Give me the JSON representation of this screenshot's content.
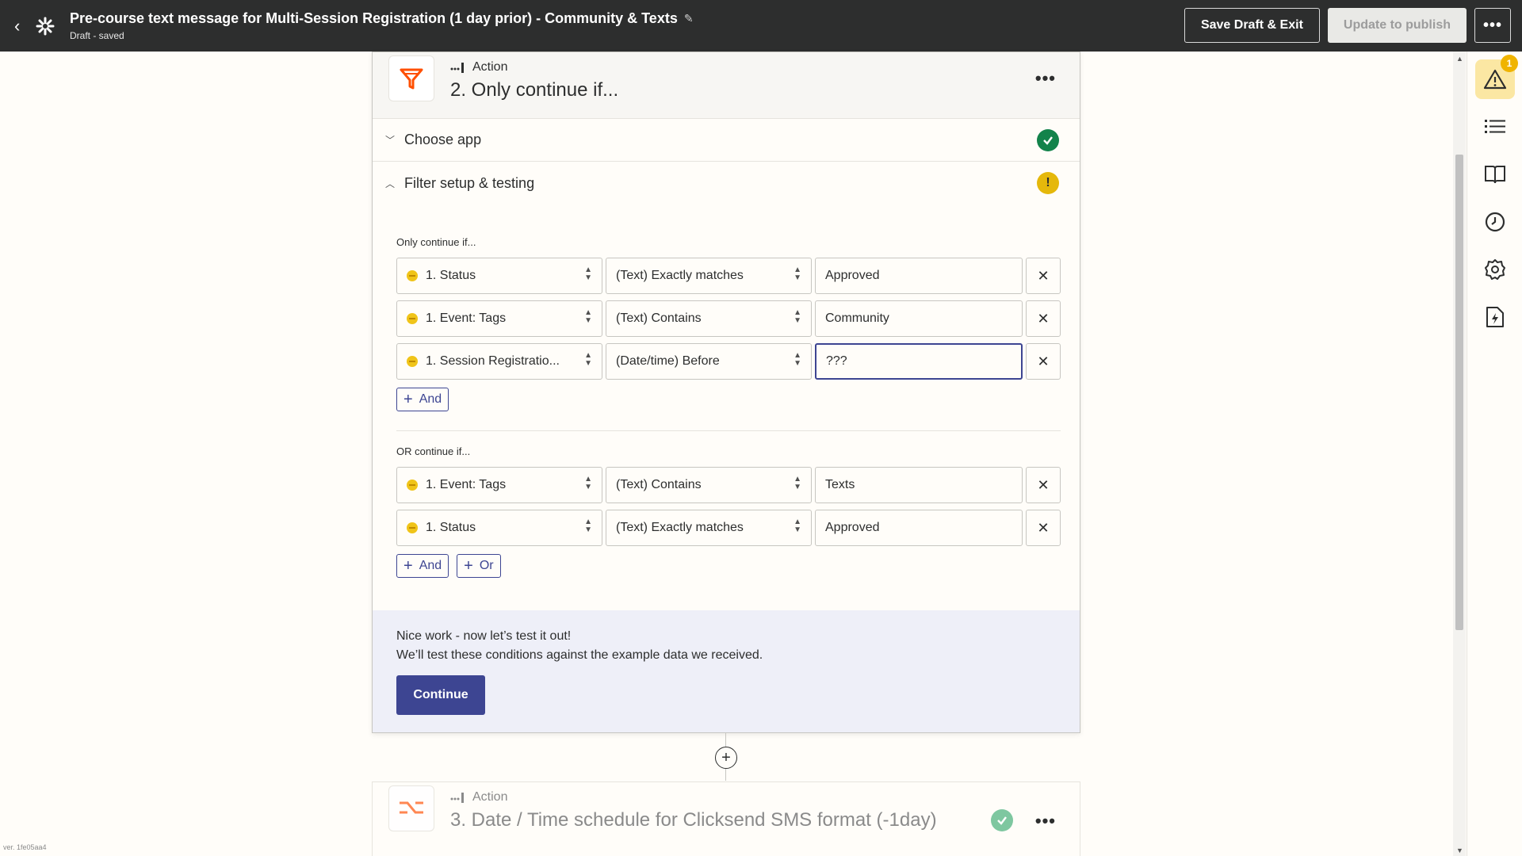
{
  "topbar": {
    "title": "Pre-course text message for Multi-Session Registration (1 day prior) - Community & Texts",
    "status": "Draft - saved",
    "save_draft_label": "Save Draft & Exit",
    "publish_label": "Update to publish",
    "more_label": "•••"
  },
  "step2": {
    "kind": "Action",
    "title": "2. Only continue if...",
    "more_label": "•••",
    "sections": {
      "choose_app": "Choose app",
      "filter": "Filter setup & testing"
    },
    "and_group_label": "Only continue if...",
    "and_rules": [
      {
        "field": "1. Status",
        "operator": "(Text) Exactly matches",
        "value": "Approved"
      },
      {
        "field": "1. Event: Tags",
        "operator": "(Text) Contains",
        "value": "Community"
      },
      {
        "field": "1. Session Registratio...",
        "operator": "(Date/time) Before",
        "value": "???"
      }
    ],
    "or_group_label": "OR continue if...",
    "or_rules": [
      {
        "field": "1. Event: Tags",
        "operator": "(Text) Contains",
        "value": "Texts"
      },
      {
        "field": "1. Status",
        "operator": "(Text) Exactly matches",
        "value": "Approved"
      }
    ],
    "and_button": "And",
    "or_button": "Or",
    "test_title": "Nice work - now let’s test it out!",
    "test_sub": "We’ll test these conditions against the example data we received.",
    "continue_label": "Continue"
  },
  "step3": {
    "kind": "Action",
    "title": "3. Date / Time schedule for Clicksend SMS format (-1day)",
    "more_label": "•••"
  },
  "rail": {
    "warning_count": "1"
  },
  "version": "ver. 1fe05aa4",
  "colors": {
    "topbar": "#2d2e2e",
    "primary": "#3d4592",
    "success": "#13834b",
    "warning": "#e5b80b",
    "filter_orange": "#ff4f00"
  }
}
